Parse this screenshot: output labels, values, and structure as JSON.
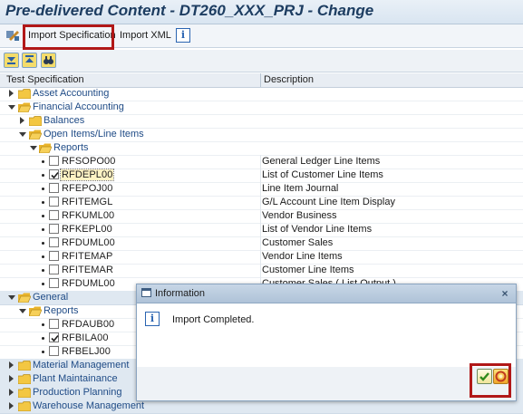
{
  "window": {
    "title": "Pre-delivered Content - DT260_XXX_PRJ  - Change"
  },
  "toolbar": {
    "import_spec_label": "Import Specification",
    "import_xml_label": "Import XML"
  },
  "columns": {
    "test_spec": "Test Specification",
    "description": "Description"
  },
  "tree": {
    "asset_accounting": "Asset Accounting",
    "financial_accounting": "Financial Accounting",
    "balances": "Balances",
    "open_items": "Open Items/Line Items",
    "reports": "Reports",
    "items_fa": [
      {
        "code": "RFSOPO00",
        "desc": "General Ledger Line Items",
        "checked": false
      },
      {
        "code": "RFDEPL00",
        "desc": "List of Customer Line Items",
        "checked": true
      },
      {
        "code": "RFEPOJ00",
        "desc": "Line Item Journal",
        "checked": false
      },
      {
        "code": "RFITEMGL",
        "desc": "G/L Account Line Item Display",
        "checked": false
      },
      {
        "code": "RFKUML00",
        "desc": "Vendor Business",
        "checked": false
      },
      {
        "code": "RFKEPL00",
        "desc": "List of Vendor Line Items",
        "checked": false
      },
      {
        "code": "RFDUML00",
        "desc": "Customer Sales",
        "checked": false
      },
      {
        "code": "RFITEMAP",
        "desc": "Vendor Line Items",
        "checked": false
      },
      {
        "code": "RFITEMAR",
        "desc": "Customer Line Items",
        "checked": false
      },
      {
        "code": "RFDUML00",
        "desc": "Customer Sales ( List Output )",
        "checked": false
      }
    ],
    "general": "General",
    "reports2": "Reports",
    "items_gen": [
      {
        "code": "RFDAUB00",
        "checked": false
      },
      {
        "code": "RFBILA00",
        "checked": true
      },
      {
        "code": "RFBELJ00",
        "checked": false
      }
    ],
    "material_management": "Material Management",
    "plant_maintainance": "Plant Maintainance",
    "production_planning": "Production Planning",
    "warehouse_management": "Warehouse Management"
  },
  "dialog": {
    "title": "Information",
    "message": "Import Completed."
  },
  "colors": {
    "highlight": "#b11818",
    "folder": "#f3c742",
    "link": "#1f4b86"
  }
}
